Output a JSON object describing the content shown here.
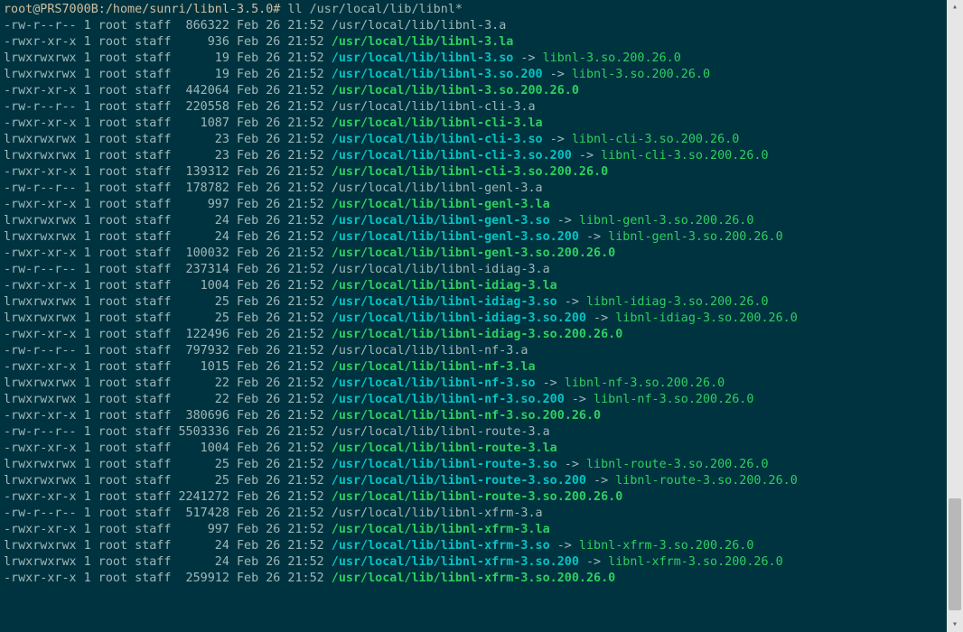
{
  "prompt": {
    "text": "root@PRS7000B:/home/sunri/libnl-3.5.0#",
    "command": "ll /usr/local/lib/libnl*"
  },
  "lines": [
    {
      "perm": "-rw-r--r--",
      "links": "1",
      "owner": "root",
      "group": "staff",
      "size": "866322",
      "date": "Feb 26 21:52",
      "file": "/usr/local/lib/libnl-3.a",
      "file_class": "default"
    },
    {
      "perm": "-rwxr-xr-x",
      "links": "1",
      "owner": "root",
      "group": "staff",
      "size": "936",
      "date": "Feb 26 21:52",
      "file": "/usr/local/lib/libnl-3.la",
      "file_class": "la"
    },
    {
      "perm": "lrwxrwxrwx",
      "links": "1",
      "owner": "root",
      "group": "staff",
      "size": "19",
      "date": "Feb 26 21:52",
      "file": "/usr/local/lib/libnl-3.so",
      "file_class": "so",
      "arrow": " -> ",
      "target": "libnl-3.so.200.26.0"
    },
    {
      "perm": "lrwxrwxrwx",
      "links": "1",
      "owner": "root",
      "group": "staff",
      "size": "19",
      "date": "Feb 26 21:52",
      "file": "/usr/local/lib/libnl-3.so.200",
      "file_class": "so",
      "arrow": " -> ",
      "target": "libnl-3.so.200.26.0"
    },
    {
      "perm": "-rwxr-xr-x",
      "links": "1",
      "owner": "root",
      "group": "staff",
      "size": "442064",
      "date": "Feb 26 21:52",
      "file": "/usr/local/lib/libnl-3.so.200.26.0",
      "file_class": "la"
    },
    {
      "perm": "-rw-r--r--",
      "links": "1",
      "owner": "root",
      "group": "staff",
      "size": "220558",
      "date": "Feb 26 21:52",
      "file": "/usr/local/lib/libnl-cli-3.a",
      "file_class": "default"
    },
    {
      "perm": "-rwxr-xr-x",
      "links": "1",
      "owner": "root",
      "group": "staff",
      "size": "1087",
      "date": "Feb 26 21:52",
      "file": "/usr/local/lib/libnl-cli-3.la",
      "file_class": "la"
    },
    {
      "perm": "lrwxrwxrwx",
      "links": "1",
      "owner": "root",
      "group": "staff",
      "size": "23",
      "date": "Feb 26 21:52",
      "file": "/usr/local/lib/libnl-cli-3.so",
      "file_class": "so",
      "arrow": " -> ",
      "target": "libnl-cli-3.so.200.26.0"
    },
    {
      "perm": "lrwxrwxrwx",
      "links": "1",
      "owner": "root",
      "group": "staff",
      "size": "23",
      "date": "Feb 26 21:52",
      "file": "/usr/local/lib/libnl-cli-3.so.200",
      "file_class": "so",
      "arrow": " -> ",
      "target": "libnl-cli-3.so.200.26.0"
    },
    {
      "perm": "-rwxr-xr-x",
      "links": "1",
      "owner": "root",
      "group": "staff",
      "size": "139312",
      "date": "Feb 26 21:52",
      "file": "/usr/local/lib/libnl-cli-3.so.200.26.0",
      "file_class": "la"
    },
    {
      "perm": "-rw-r--r--",
      "links": "1",
      "owner": "root",
      "group": "staff",
      "size": "178782",
      "date": "Feb 26 21:52",
      "file": "/usr/local/lib/libnl-genl-3.a",
      "file_class": "default"
    },
    {
      "perm": "-rwxr-xr-x",
      "links": "1",
      "owner": "root",
      "group": "staff",
      "size": "997",
      "date": "Feb 26 21:52",
      "file": "/usr/local/lib/libnl-genl-3.la",
      "file_class": "la"
    },
    {
      "perm": "lrwxrwxrwx",
      "links": "1",
      "owner": "root",
      "group": "staff",
      "size": "24",
      "date": "Feb 26 21:52",
      "file": "/usr/local/lib/libnl-genl-3.so",
      "file_class": "so",
      "arrow": " -> ",
      "target": "libnl-genl-3.so.200.26.0"
    },
    {
      "perm": "lrwxrwxrwx",
      "links": "1",
      "owner": "root",
      "group": "staff",
      "size": "24",
      "date": "Feb 26 21:52",
      "file": "/usr/local/lib/libnl-genl-3.so.200",
      "file_class": "so",
      "arrow": " -> ",
      "target": "libnl-genl-3.so.200.26.0"
    },
    {
      "perm": "-rwxr-xr-x",
      "links": "1",
      "owner": "root",
      "group": "staff",
      "size": "100032",
      "date": "Feb 26 21:52",
      "file": "/usr/local/lib/libnl-genl-3.so.200.26.0",
      "file_class": "la"
    },
    {
      "perm": "-rw-r--r--",
      "links": "1",
      "owner": "root",
      "group": "staff",
      "size": "237314",
      "date": "Feb 26 21:52",
      "file": "/usr/local/lib/libnl-idiag-3.a",
      "file_class": "default"
    },
    {
      "perm": "-rwxr-xr-x",
      "links": "1",
      "owner": "root",
      "group": "staff",
      "size": "1004",
      "date": "Feb 26 21:52",
      "file": "/usr/local/lib/libnl-idiag-3.la",
      "file_class": "la"
    },
    {
      "perm": "lrwxrwxrwx",
      "links": "1",
      "owner": "root",
      "group": "staff",
      "size": "25",
      "date": "Feb 26 21:52",
      "file": "/usr/local/lib/libnl-idiag-3.so",
      "file_class": "so",
      "arrow": " -> ",
      "target": "libnl-idiag-3.so.200.26.0"
    },
    {
      "perm": "lrwxrwxrwx",
      "links": "1",
      "owner": "root",
      "group": "staff",
      "size": "25",
      "date": "Feb 26 21:52",
      "file": "/usr/local/lib/libnl-idiag-3.so.200",
      "file_class": "so",
      "arrow": " -> ",
      "target": "libnl-idiag-3.so.200.26.0"
    },
    {
      "perm": "-rwxr-xr-x",
      "links": "1",
      "owner": "root",
      "group": "staff",
      "size": "122496",
      "date": "Feb 26 21:52",
      "file": "/usr/local/lib/libnl-idiag-3.so.200.26.0",
      "file_class": "la"
    },
    {
      "perm": "-rw-r--r--",
      "links": "1",
      "owner": "root",
      "group": "staff",
      "size": "797932",
      "date": "Feb 26 21:52",
      "file": "/usr/local/lib/libnl-nf-3.a",
      "file_class": "default"
    },
    {
      "perm": "-rwxr-xr-x",
      "links": "1",
      "owner": "root",
      "group": "staff",
      "size": "1015",
      "date": "Feb 26 21:52",
      "file": "/usr/local/lib/libnl-nf-3.la",
      "file_class": "la"
    },
    {
      "perm": "lrwxrwxrwx",
      "links": "1",
      "owner": "root",
      "group": "staff",
      "size": "22",
      "date": "Feb 26 21:52",
      "file": "/usr/local/lib/libnl-nf-3.so",
      "file_class": "so",
      "arrow": " -> ",
      "target": "libnl-nf-3.so.200.26.0"
    },
    {
      "perm": "lrwxrwxrwx",
      "links": "1",
      "owner": "root",
      "group": "staff",
      "size": "22",
      "date": "Feb 26 21:52",
      "file": "/usr/local/lib/libnl-nf-3.so.200",
      "file_class": "so",
      "arrow": " -> ",
      "target": "libnl-nf-3.so.200.26.0"
    },
    {
      "perm": "-rwxr-xr-x",
      "links": "1",
      "owner": "root",
      "group": "staff",
      "size": "380696",
      "date": "Feb 26 21:52",
      "file": "/usr/local/lib/libnl-nf-3.so.200.26.0",
      "file_class": "la"
    },
    {
      "perm": "-rw-r--r--",
      "links": "1",
      "owner": "root",
      "group": "staff",
      "size": "5503336",
      "date": "Feb 26 21:52",
      "file": "/usr/local/lib/libnl-route-3.a",
      "file_class": "default"
    },
    {
      "perm": "-rwxr-xr-x",
      "links": "1",
      "owner": "root",
      "group": "staff",
      "size": "1004",
      "date": "Feb 26 21:52",
      "file": "/usr/local/lib/libnl-route-3.la",
      "file_class": "la"
    },
    {
      "perm": "lrwxrwxrwx",
      "links": "1",
      "owner": "root",
      "group": "staff",
      "size": "25",
      "date": "Feb 26 21:52",
      "file": "/usr/local/lib/libnl-route-3.so",
      "file_class": "so",
      "arrow": " -> ",
      "target": "libnl-route-3.so.200.26.0"
    },
    {
      "perm": "lrwxrwxrwx",
      "links": "1",
      "owner": "root",
      "group": "staff",
      "size": "25",
      "date": "Feb 26 21:52",
      "file": "/usr/local/lib/libnl-route-3.so.200",
      "file_class": "so",
      "arrow": " -> ",
      "target": "libnl-route-3.so.200.26.0"
    },
    {
      "perm": "-rwxr-xr-x",
      "links": "1",
      "owner": "root",
      "group": "staff",
      "size": "2241272",
      "date": "Feb 26 21:52",
      "file": "/usr/local/lib/libnl-route-3.so.200.26.0",
      "file_class": "la"
    },
    {
      "perm": "-rw-r--r--",
      "links": "1",
      "owner": "root",
      "group": "staff",
      "size": "517428",
      "date": "Feb 26 21:52",
      "file": "/usr/local/lib/libnl-xfrm-3.a",
      "file_class": "default"
    },
    {
      "perm": "-rwxr-xr-x",
      "links": "1",
      "owner": "root",
      "group": "staff",
      "size": "997",
      "date": "Feb 26 21:52",
      "file": "/usr/local/lib/libnl-xfrm-3.la",
      "file_class": "la"
    },
    {
      "perm": "lrwxrwxrwx",
      "links": "1",
      "owner": "root",
      "group": "staff",
      "size": "24",
      "date": "Feb 26 21:52",
      "file": "/usr/local/lib/libnl-xfrm-3.so",
      "file_class": "so",
      "arrow": " -> ",
      "target": "libnl-xfrm-3.so.200.26.0"
    },
    {
      "perm": "lrwxrwxrwx",
      "links": "1",
      "owner": "root",
      "group": "staff",
      "size": "24",
      "date": "Feb 26 21:52",
      "file": "/usr/local/lib/libnl-xfrm-3.so.200",
      "file_class": "so",
      "arrow": " -> ",
      "target": "libnl-xfrm-3.so.200.26.0"
    },
    {
      "perm": "-rwxr-xr-x",
      "links": "1",
      "owner": "root",
      "group": "staff",
      "size": "259912",
      "date": "Feb 26 21:52",
      "file": "/usr/local/lib/libnl-xfrm-3.so.200.26.0",
      "file_class": "la"
    }
  ],
  "size_width": 7
}
